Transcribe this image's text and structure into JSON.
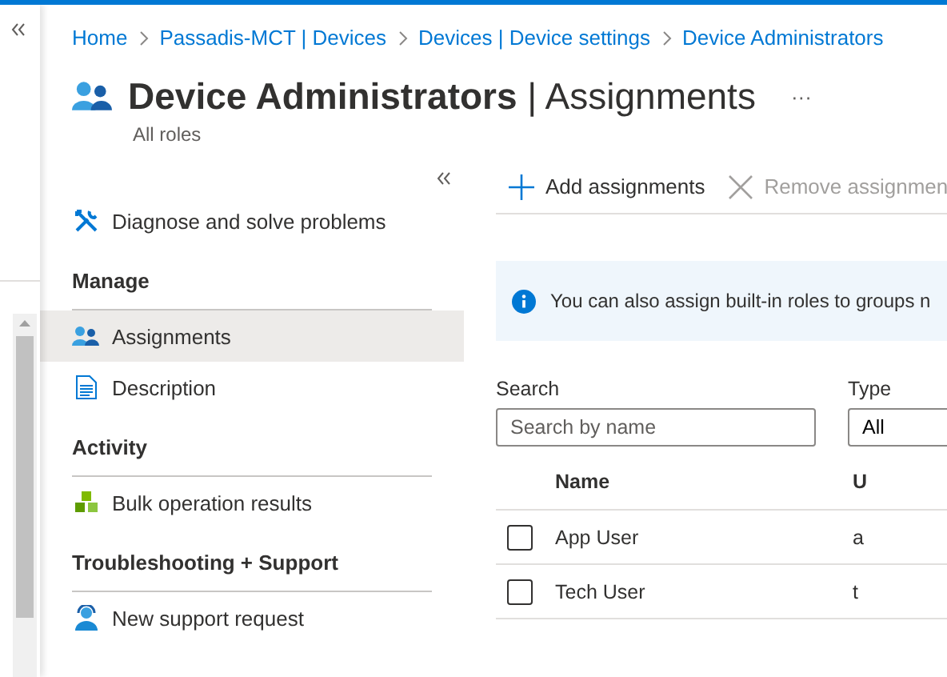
{
  "breadcrumb": [
    "Home",
    "Passadis-MCT | Devices",
    "Devices | Device settings",
    "Device Administrators"
  ],
  "title": {
    "name": "Device Administrators",
    "separator": "|",
    "section": "Assignments",
    "subtitle": "All roles",
    "more": "···"
  },
  "menu": [
    {
      "kind": "item",
      "label": "Diagnose and solve problems",
      "selected": false
    },
    {
      "kind": "heading",
      "label": "Manage"
    },
    {
      "kind": "item",
      "label": "Assignments",
      "selected": true
    },
    {
      "kind": "item",
      "label": "Description",
      "selected": false
    },
    {
      "kind": "heading",
      "label": "Activity"
    },
    {
      "kind": "item",
      "label": "Bulk operation results",
      "selected": false
    },
    {
      "kind": "heading",
      "label": "Troubleshooting + Support"
    },
    {
      "kind": "item",
      "label": "New support request",
      "selected": false
    }
  ],
  "toolbar": [
    {
      "label": "Add assignments",
      "disabled": false
    },
    {
      "label": "Remove assignmen",
      "disabled": true
    }
  ],
  "info": "You can also assign built-in roles to groups n",
  "filters": {
    "search": {
      "label": "Search",
      "placeholder": "Search by name"
    },
    "type": {
      "label": "Type",
      "value": "All"
    }
  },
  "table": {
    "columns": [
      "Name",
      "U"
    ],
    "rows": [
      {
        "checked": false,
        "cells": [
          "App User",
          "a"
        ]
      },
      {
        "checked": false,
        "cells": [
          "Tech User",
          "t"
        ]
      }
    ]
  }
}
